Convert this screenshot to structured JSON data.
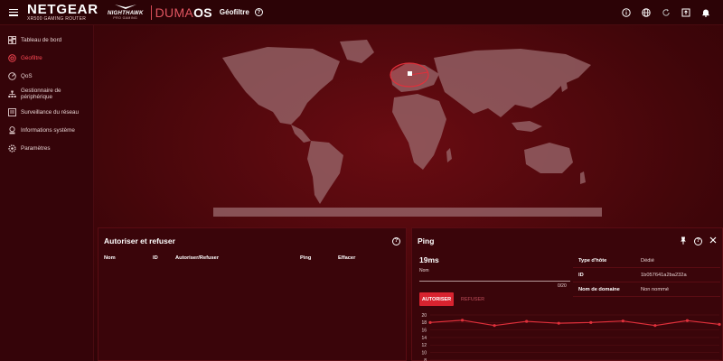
{
  "header": {
    "brand": "NETGEAR",
    "model": "XR500 GAMING ROUTER",
    "nighthawk": "NIGHTHAWK",
    "nighthawk_sub": "PRO GAMING",
    "os_prefix": "DUMA",
    "os_suffix": "OS",
    "page_title": "Géofiltre",
    "help": "?",
    "icons": [
      "info-icon",
      "globe-icon",
      "refresh-icon",
      "upload-icon",
      "bell-icon"
    ]
  },
  "sidebar": {
    "items": [
      {
        "label": "Tableau de bord",
        "icon": "dashboard-icon",
        "active": false
      },
      {
        "label": "Géofiltre",
        "icon": "geofilter-icon",
        "active": true
      },
      {
        "label": "QoS",
        "icon": "gauge-icon",
        "active": false
      },
      {
        "label": "Gestionnaire de périphérique",
        "icon": "network-icon",
        "active": false
      },
      {
        "label": "Surveillance du réseau",
        "icon": "monitor-icon",
        "active": false
      },
      {
        "label": "Informations système",
        "icon": "system-info-icon",
        "active": false
      },
      {
        "label": "Paramètres",
        "icon": "settings-icon",
        "active": false
      }
    ]
  },
  "allow_panel": {
    "title": "Autoriser et refuser",
    "columns": [
      "Nom",
      "ID",
      "Autoriser/Refuser",
      "Ping",
      "Effacer"
    ]
  },
  "ping_panel": {
    "title": "Ping",
    "value": "19ms",
    "name_label": "Nom",
    "count": "0/20",
    "info": [
      {
        "key": "Type d'hôte",
        "value": "Dédié"
      },
      {
        "key": "ID",
        "value": "1b057641a2ba232a"
      },
      {
        "key": "Nom de domaine",
        "value": "Non nommé"
      }
    ],
    "allow_button": "AUTORISER",
    "refuse_button": "REFUSER",
    "y_ticks": [
      "20",
      "18",
      "16",
      "14",
      "12",
      "10",
      "8"
    ]
  },
  "chart_data": {
    "type": "line",
    "series": [
      {
        "values": [
          18,
          18.6,
          17.2,
          18.3,
          17.8,
          18,
          18.4,
          17.2,
          18.5,
          17.5
        ]
      }
    ],
    "ylim": [
      8,
      20
    ],
    "yticks": [
      20,
      18,
      16,
      14,
      12,
      10,
      8
    ]
  },
  "colors": {
    "accent": "#d8232f",
    "accent_text": "#ff4a55",
    "background": "#3e0509",
    "line": "#e0303b"
  }
}
